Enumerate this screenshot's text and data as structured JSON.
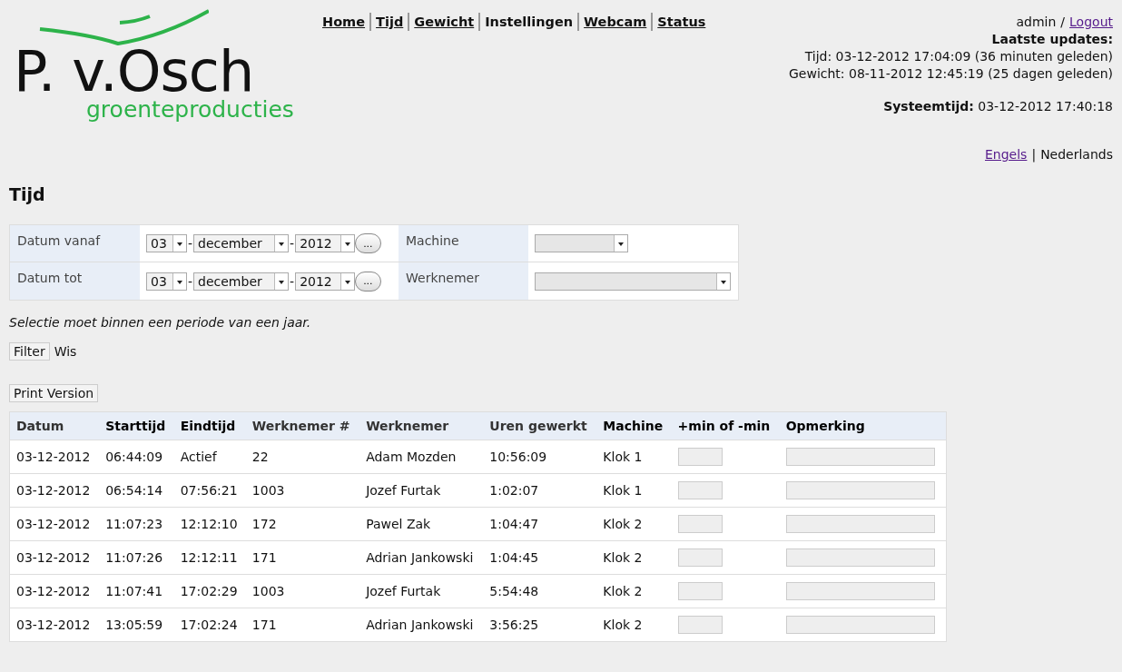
{
  "logo": {
    "name": "P. v.Osch",
    "tagline": "groenteproducties"
  },
  "nav": [
    {
      "label": "Home",
      "link": true
    },
    {
      "label": "Tijd",
      "link": true
    },
    {
      "label": "Gewicht",
      "link": true
    },
    {
      "label": "Instellingen",
      "link": false
    },
    {
      "label": "Webcam",
      "link": true
    },
    {
      "label": "Status",
      "link": true
    }
  ],
  "user": {
    "name": "admin",
    "separator": "/",
    "logout": "Logout"
  },
  "updates": {
    "title": "Laatste updates:",
    "lines": [
      "Tijd: 03-12-2012 17:04:09 (36 minuten geleden)",
      "Gewicht: 08-11-2012 12:45:19 (25 dagen geleden)"
    ]
  },
  "system_time": "**Systeemtijd:** 03-12-2012 17:40:18",
  "languages": [
    {
      "label": "Engels",
      "selected": false
    },
    {
      "label": "Nederlands",
      "selected": true
    }
  ],
  "language_separator": "|",
  "heading": "Tijd",
  "filter": {
    "rows": [
      {
        "label": "Datum vanaf",
        "day": "03",
        "month": "december",
        "year": "2012",
        "date_separator": "-",
        "picker": "...",
        "field_label": "Machine",
        "field_value": "",
        "wide": false
      },
      {
        "label": "Datum tot",
        "day": "03",
        "month": "december",
        "year": "2012",
        "date_separator": "-",
        "picker": "...",
        "field_label": "Werknemer",
        "field_value": "",
        "wide": true
      }
    ],
    "note": "Selectie moet binnen een periode van een jaar.",
    "filter_button": "Filter",
    "clear_link": "Wis",
    "print_button": "Print Version"
  },
  "table": {
    "columns": [
      {
        "label": "Datum",
        "sortable": true
      },
      {
        "label": "Starttijd",
        "sortable": false
      },
      {
        "label": "Eindtijd",
        "sortable": false
      },
      {
        "label": "Werknemer #",
        "sortable": true
      },
      {
        "label": "Werknemer",
        "sortable": true
      },
      {
        "label": "Uren gewerkt",
        "sortable": true
      },
      {
        "label": "Machine",
        "sortable": false
      },
      {
        "label": "+min of -min",
        "sortable": false
      },
      {
        "label": "Opmerking",
        "sortable": false
      }
    ],
    "rows": [
      [
        "03-12-2012",
        "06:44:09",
        "Actief",
        "22",
        "Adam Mozden",
        "10:56:09",
        "Klok 1"
      ],
      [
        "03-12-2012",
        "06:54:14",
        "07:56:21",
        "1003",
        "Jozef Furtak",
        "1:02:07",
        "Klok 1"
      ],
      [
        "03-12-2012",
        "11:07:23",
        "12:12:10",
        "172",
        "Pawel Zak",
        "1:04:47",
        "Klok 2"
      ],
      [
        "03-12-2012",
        "11:07:26",
        "12:12:11",
        "171",
        "Adrian Jankowski",
        "1:04:45",
        "Klok 2"
      ],
      [
        "03-12-2012",
        "11:07:41",
        "17:02:29",
        "1003",
        "Jozef Furtak",
        "5:54:48",
        "Klok 2"
      ],
      [
        "03-12-2012",
        "13:05:59",
        "17:02:24",
        "171",
        "Adrian Jankowski",
        "3:56:25",
        "Klok 2"
      ]
    ]
  }
}
